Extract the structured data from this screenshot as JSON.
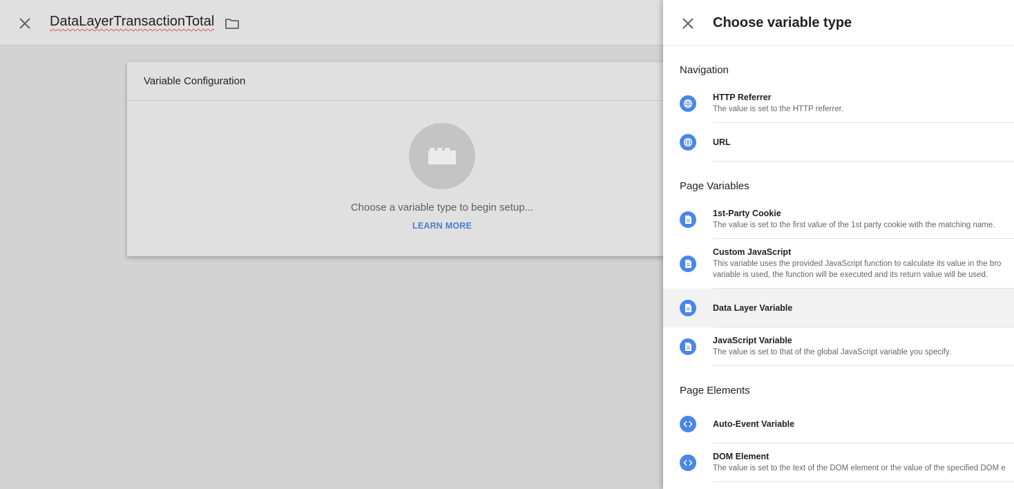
{
  "editor": {
    "title": "DataLayerTransactionTotal",
    "card": {
      "title": "Variable Configuration",
      "empty_text": "Choose a variable type to begin setup...",
      "learn_more": "LEARN MORE"
    }
  },
  "panel": {
    "title": "Choose variable type",
    "sections": {
      "navigation": {
        "title": "Navigation",
        "items": [
          {
            "name": "HTTP Referrer",
            "desc": "The value is set to the HTTP referrer."
          },
          {
            "name": "URL",
            "desc": ""
          }
        ]
      },
      "page_variables": {
        "title": "Page Variables",
        "items": [
          {
            "name": "1st-Party Cookie",
            "desc": "The value is set to the first value of the 1st party cookie with the matching name."
          },
          {
            "name": "Custom JavaScript",
            "desc": "This variable uses the provided JavaScript function to calculate its value in the bro",
            "desc2": "variable is used, the function will be executed and its return value will be used."
          },
          {
            "name": "Data Layer Variable",
            "desc": ""
          },
          {
            "name": "JavaScript Variable",
            "desc": "The value is set to that of the global JavaScript variable you specify."
          }
        ]
      },
      "page_elements": {
        "title": "Page Elements",
        "items": [
          {
            "name": "Auto-Event Variable",
            "desc": ""
          },
          {
            "name": "DOM Element",
            "desc": "The value is set to the text of the DOM element or the value of the specified DOM e"
          }
        ]
      }
    }
  },
  "icons": {
    "close": "close-icon",
    "folder": "folder-icon",
    "navigation": "globe-icon",
    "page_variables": "document-icon",
    "page_elements": "code-icon",
    "empty_state": "block-icon"
  },
  "colors": {
    "accent": "#4a86e8",
    "link": "#4a7fd4",
    "selected_row": "#f2f2f2"
  }
}
